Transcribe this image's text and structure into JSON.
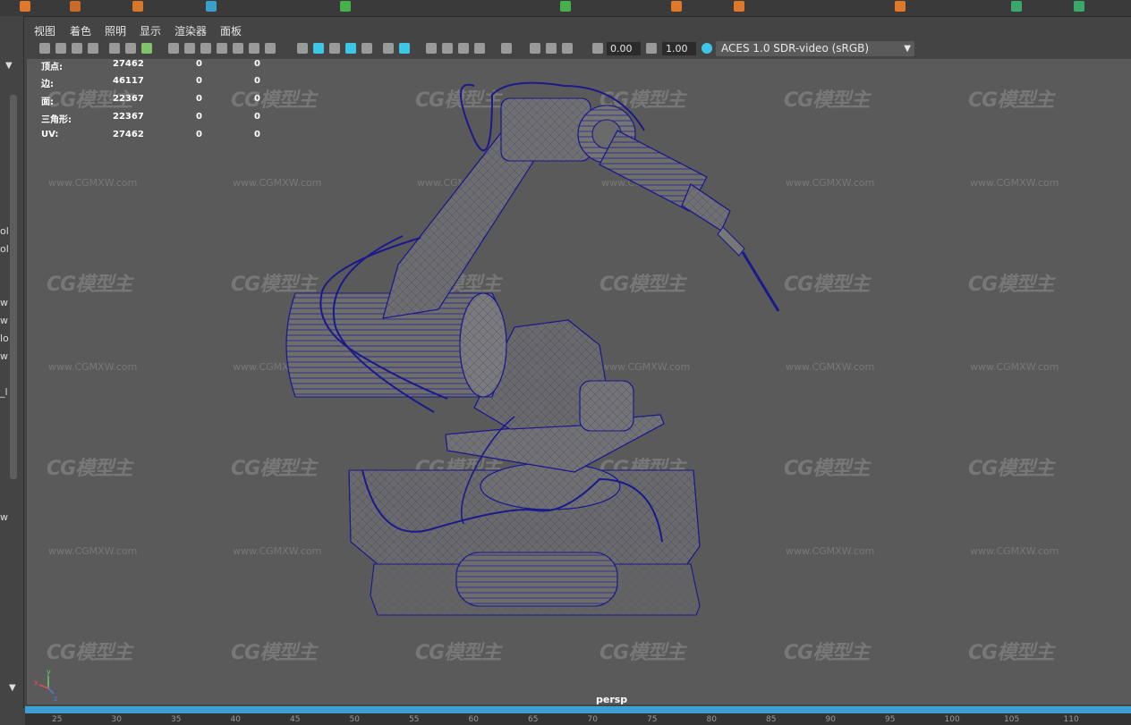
{
  "panel_menu": {
    "view": "视图",
    "shading": "着色",
    "lighting": "照明",
    "show": "显示",
    "renderer": "渲染器",
    "panels": "面板"
  },
  "toolbar": {
    "exposure": "0.00",
    "gamma": "1.00",
    "color_space": "ACES 1.0 SDR-video (sRGB)"
  },
  "hud": {
    "rows": [
      {
        "label": "顶点:",
        "v1": "27462",
        "v2": "0",
        "v3": "0"
      },
      {
        "label": "边:",
        "v1": "46117",
        "v2": "0",
        "v3": "0"
      },
      {
        "label": "面:",
        "v1": "22367",
        "v2": "0",
        "v3": "0"
      },
      {
        "label": "三角形:",
        "v1": "22367",
        "v2": "0",
        "v3": "0"
      },
      {
        "label": "UV:",
        "v1": "27462",
        "v2": "0",
        "v3": "0"
      }
    ]
  },
  "camera_label": "persp",
  "axis": {
    "y": "y",
    "x": "x",
    "z": "z"
  },
  "watermark": {
    "logo": "CG模型主",
    "url": "www.CGMXW.com"
  },
  "left_fragments": [
    "ol",
    "ol",
    "w",
    "w",
    "lo",
    "w",
    "_l",
    "w"
  ],
  "timeline": {
    "ticks": [
      "25",
      "30",
      "35",
      "40",
      "45",
      "50",
      "55",
      "60",
      "65",
      "70",
      "75",
      "80",
      "85",
      "90",
      "95",
      "100",
      "105",
      "110"
    ]
  },
  "colors": {
    "viewport_bg": "#5a5a5a",
    "wireframe": "#1a1a8c",
    "timebar": "#3ea0d2",
    "selected_icon": "#3ec6e6"
  }
}
